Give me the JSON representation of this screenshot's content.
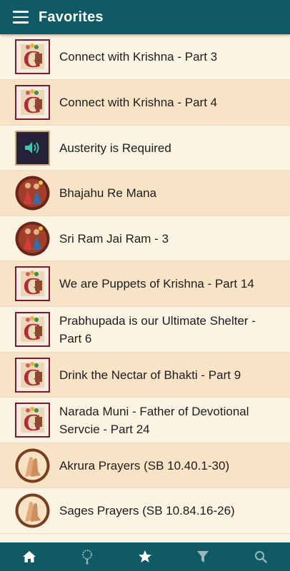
{
  "header": {
    "title": "Favorites",
    "menu_icon": "hamburger-menu-icon"
  },
  "favorites": [
    {
      "label": "Connect with Krishna - Part 3",
      "thumb": "book"
    },
    {
      "label": "Connect with Krishna - Part 4",
      "thumb": "book"
    },
    {
      "label": "Austerity is Required",
      "thumb": "audio"
    },
    {
      "label": "Bhajahu Re Mana",
      "thumb": "dancers"
    },
    {
      "label": "Sri Ram Jai Ram - 3",
      "thumb": "dancers"
    },
    {
      "label": "We are Puppets of Krishna - Part 14",
      "thumb": "book"
    },
    {
      "label": "Prabhupada is our Ultimate Shelter - Part 6",
      "thumb": "book"
    },
    {
      "label": "Drink the Nectar of Bhakti - Part 9",
      "thumb": "book"
    },
    {
      "label": "Narada Muni - Father of Devotional Servcie - Part 24",
      "thumb": "book"
    },
    {
      "label": "Akrura Prayers (SB 10.40.1-30)",
      "thumb": "prayer"
    },
    {
      "label": "Sages Prayers (SB 10.84.16-26)",
      "thumb": "prayer"
    }
  ],
  "bottom_nav": [
    {
      "name": "home",
      "icon": "home-icon"
    },
    {
      "name": "mala",
      "icon": "japa-mala-icon"
    },
    {
      "name": "favorites",
      "icon": "star-icon"
    },
    {
      "name": "filter",
      "icon": "filter-icon"
    },
    {
      "name": "search",
      "icon": "search-icon"
    }
  ],
  "colors": {
    "bar": "#0f5a64",
    "row_light": "#fdf3e2",
    "row_dark": "#f9e3c6",
    "icon_active": "#ffffff",
    "icon_inactive": "#9bb7bb"
  }
}
